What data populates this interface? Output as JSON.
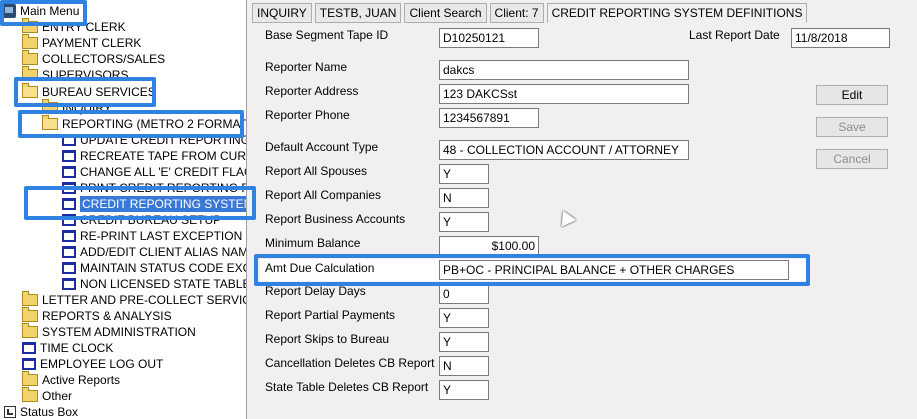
{
  "tree": {
    "main_menu": "Main Menu",
    "entry_clerk": "ENTRY CLERK",
    "payment_clerk": "PAYMENT CLERK",
    "collectors_sales": "COLLECTORS/SALES",
    "supervisors": "SUPERVISORS",
    "bureau_services": "BUREAU SERVICES",
    "inquiry": "INQUIRY",
    "reporting": "REPORTING (METRO 2 FORMAT)",
    "update_credit": "UPDATE CREDIT REPORTING F",
    "recreate_tape": "RECREATE TAPE FROM CURRE",
    "change_flags": "CHANGE ALL 'E' CREDIT FLAGS",
    "print_credit": "PRINT CREDIT REPORTING FIL",
    "credit_system": "CREDIT REPORTING SYSTEM D",
    "credit_bureau_setup": "CREDIT BUREAU SETUP",
    "reprint_exception": "RE-PRINT LAST EXCEPTION RE",
    "add_edit_alias": "ADD/EDIT CLIENT ALIAS NAMES",
    "maintain_status": "MAINTAIN STATUS CODE EXCE",
    "non_licensed": "NON LICENSED STATE TABLE",
    "letter": "LETTER AND PRE-COLLECT SERVICES",
    "reports": "REPORTS & ANALYSIS",
    "sysadmin": "SYSTEM ADMINISTRATION",
    "timeclock": "TIME CLOCK",
    "employee_logout": "EMPLOYEE LOG OUT",
    "active_reports": "Active Reports",
    "other": "Other",
    "status_box": "Status Box"
  },
  "toolbar": {
    "inquiry": "INQUIRY",
    "user": "TESTB, JUAN",
    "client_search": "Client Search",
    "client": "Client: 7",
    "title": "CREDIT REPORTING SYSTEM DEFINITIONS"
  },
  "form": {
    "base_segment_label": "Base Segment Tape ID",
    "base_segment_value": "D10250121",
    "last_report_label": "Last Report Date",
    "last_report_value": "11/8/2018",
    "reporter_name_label": "Reporter Name",
    "reporter_name_value": "dakcs",
    "reporter_address_label": "Reporter Address",
    "reporter_address_value": "123 DAKCSst",
    "reporter_phone_label": "Reporter Phone",
    "reporter_phone_value": "1234567891",
    "default_account_label": "Default Account Type",
    "default_account_value": "48 - COLLECTION ACCOUNT / ATTORNEY",
    "report_spouses_label": "Report All Spouses",
    "report_spouses_value": "Y",
    "report_companies_label": "Report All Companies",
    "report_companies_value": "N",
    "report_business_label": "Report Business Accounts",
    "report_business_value": "Y",
    "min_balance_label": "Minimum Balance",
    "min_balance_value": "$100.00",
    "amt_due_label": "Amt Due Calculation",
    "amt_due_value": "PB+OC - PRINCIPAL BALANCE + OTHER CHARGES",
    "delay_days_label": "Report Delay Days",
    "delay_days_value": "0",
    "partial_payments_label": "Report Partial Payments",
    "partial_payments_value": "Y",
    "skips_label": "Report Skips to Bureau",
    "skips_value": "Y",
    "cancel_deletes_label": "Cancellation Deletes CB Report",
    "cancel_deletes_value": "N",
    "state_table_label": "State Table Deletes CB Report",
    "state_table_value": "Y"
  },
  "actions": {
    "edit": "Edit",
    "save": "Save",
    "cancel": "Cancel"
  },
  "colors": {
    "highlight": "#2f82e2",
    "selection": "#3a78d8"
  }
}
